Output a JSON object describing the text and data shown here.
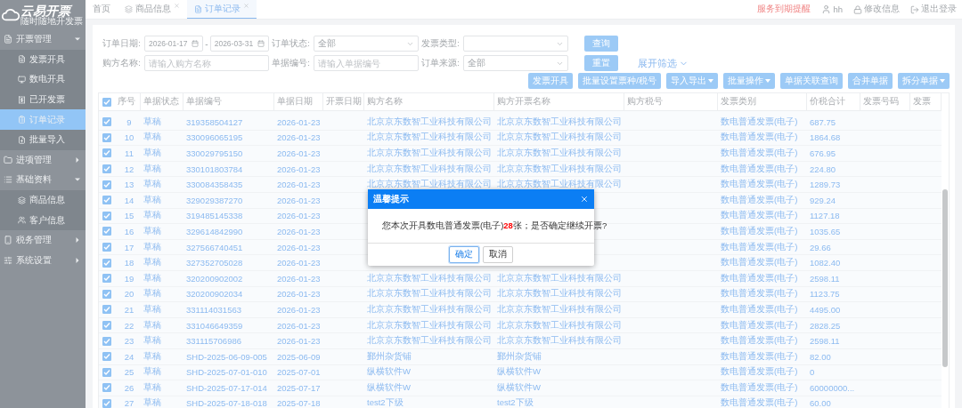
{
  "logo": {
    "name": "云易开票",
    "slogan": "随时随地开发票"
  },
  "sidebar": {
    "items": [
      {
        "label": "开票管理",
        "expanded": true,
        "children": [
          {
            "label": "发票开具",
            "selected": false
          },
          {
            "label": "数电开具",
            "selected": false
          },
          {
            "label": "已开发票",
            "selected": false
          },
          {
            "label": "订单记录",
            "selected": true
          },
          {
            "label": "批量导入",
            "selected": false
          }
        ]
      },
      {
        "label": "进项管理",
        "expanded": false
      },
      {
        "label": "基础资料",
        "expanded": true,
        "children": [
          {
            "label": "商品信息",
            "selected": false
          },
          {
            "label": "客户信息",
            "selected": false
          }
        ]
      },
      {
        "label": "税务管理",
        "expanded": false
      },
      {
        "label": "系统设置",
        "expanded": false
      }
    ]
  },
  "tabs": [
    {
      "label": "首页",
      "selected": false,
      "closable": false
    },
    {
      "label": "商品信息",
      "selected": false,
      "closable": true
    },
    {
      "label": "订单记录",
      "selected": true,
      "closable": true
    }
  ],
  "header_links": {
    "reminder": "服务到期提醒",
    "user": "hh",
    "edit_info": "修改信息",
    "logout": "退出登录"
  },
  "filters": [
    {
      "label": "订单日期:",
      "kind": "daterange",
      "from": "2026-01-17",
      "to": "2026-03-31",
      "separator": "-"
    },
    {
      "label": "订单状态:",
      "kind": "select",
      "value": "全部"
    },
    {
      "label": "发票类型:",
      "kind": "select"
    },
    {
      "label": "购方名称:",
      "kind": "input",
      "placeholder": "请输入购方名称"
    },
    {
      "label": "单据编号:",
      "kind": "input",
      "placeholder": "请输入单据编号"
    },
    {
      "label": "订单来源:",
      "kind": "select",
      "value": "全部"
    }
  ],
  "search_buttons": [
    "查询",
    "重置"
  ],
  "expand_link": "展开筛选",
  "actions": [
    {
      "label": "发票开具",
      "dropdown": false
    },
    {
      "label": "批量设置票种/税号",
      "dropdown": false
    },
    {
      "label": "导入导出",
      "dropdown": true
    },
    {
      "label": "批量操作",
      "dropdown": true
    },
    {
      "label": "单据关联查询",
      "dropdown": false
    },
    {
      "label": "合并单据",
      "dropdown": false
    },
    {
      "label": "拆分单据",
      "dropdown": true
    }
  ],
  "table": {
    "all_checked": true,
    "columns": [
      "序号",
      "单据状态",
      "单据编号",
      "单据日期",
      "开票日期",
      "购方名称",
      "购方开票名称",
      "购方税号",
      "发票类别",
      "价税合计",
      "发票号码",
      "发票"
    ],
    "rows": [
      {
        "checked": true,
        "no": "9",
        "status": "草稿",
        "code": "319358504127",
        "date": "2026-01-23",
        "buyer": "北京京东数智工业科技有限公司",
        "invoice_name": "北京京东数智工业科技有限公司",
        "type": "数电普通发票(电子)",
        "total": "687.75"
      },
      {
        "checked": true,
        "no": "10",
        "status": "草稿",
        "code": "330096065195",
        "date": "2026-01-23",
        "buyer": "北京京东数智工业科技有限公司",
        "invoice_name": "北京京东数智工业科技有限公司",
        "type": "数电普通发票(电子)",
        "total": "1864.68"
      },
      {
        "checked": true,
        "no": "11",
        "status": "草稿",
        "code": "330029795150",
        "date": "2026-01-23",
        "buyer": "北京京东数智工业科技有限公司",
        "invoice_name": "北京京东数智工业科技有限公司",
        "type": "数电普通发票(电子)",
        "total": "676.95"
      },
      {
        "checked": true,
        "no": "12",
        "status": "草稿",
        "code": "330101803784",
        "date": "2026-01-23",
        "buyer": "北京京东数智工业科技有限公司",
        "invoice_name": "北京京东数智工业科技有限公司",
        "type": "数电普通发票(电子)",
        "total": "224.80"
      },
      {
        "checked": true,
        "no": "13",
        "status": "草稿",
        "code": "330084358435",
        "date": "2026-01-23",
        "buyer": "北京京东数智工业科技有限公司",
        "invoice_name": "北京京东数智工业科技有限公司",
        "type": "数电普通发票(电子)",
        "total": "1289.73"
      },
      {
        "checked": true,
        "no": "14",
        "status": "草稿",
        "code": "329029387270",
        "date": "2026-01-23",
        "type": "数电普通发票(电子)",
        "total": "929.24"
      },
      {
        "checked": true,
        "no": "15",
        "status": "草稿",
        "code": "319485145338",
        "date": "2026-01-23",
        "type": "数电普通发票(电子)",
        "total": "1127.18"
      },
      {
        "checked": true,
        "no": "16",
        "status": "草稿",
        "code": "329614842990",
        "date": "2026-01-23",
        "type": "数电普通发票(电子)",
        "total": "1035.65"
      },
      {
        "checked": true,
        "no": "17",
        "status": "草稿",
        "code": "327566740451",
        "date": "2026-01-23",
        "type": "数电普通发票(电子)",
        "total": "29.66"
      },
      {
        "checked": true,
        "no": "18",
        "status": "草稿",
        "code": "327352705028",
        "date": "2026-01-23",
        "type": "数电普通发票(电子)",
        "total": "1082.40"
      },
      {
        "checked": true,
        "no": "19",
        "status": "草稿",
        "code": "320200902002",
        "date": "2026-01-23",
        "buyer": "北京京东数智工业科技有限公司",
        "invoice_name": "北京京东数智工业科技有限公司",
        "type": "数电普通发票(电子)",
        "total": "2598.11"
      },
      {
        "checked": true,
        "no": "20",
        "status": "草稿",
        "code": "320200902034",
        "date": "2026-01-23",
        "buyer": "北京京东数智工业科技有限公司",
        "invoice_name": "北京京东数智工业科技有限公司",
        "type": "数电普通发票(电子)",
        "total": "1123.75"
      },
      {
        "checked": true,
        "no": "21",
        "status": "草稿",
        "code": "331114031563",
        "date": "2026-01-23",
        "buyer": "北京京东数智工业科技有限公司",
        "invoice_name": "北京京东数智工业科技有限公司",
        "type": "数电普通发票(电子)",
        "total": "4495.00"
      },
      {
        "checked": true,
        "no": "22",
        "status": "草稿",
        "code": "331046649359",
        "date": "2026-01-23",
        "buyer": "北京京东数智工业科技有限公司",
        "invoice_name": "北京京东数智工业科技有限公司",
        "type": "数电普通发票(电子)",
        "total": "2828.25"
      },
      {
        "checked": true,
        "no": "23",
        "status": "草稿",
        "code": "331115706986",
        "date": "2026-01-23",
        "buyer": "北京京东数智工业科技有限公司",
        "invoice_name": "北京京东数智工业科技有限公司",
        "type": "数电普通发票(电子)",
        "total": "2598.11"
      },
      {
        "checked": true,
        "no": "24",
        "status": "草稿",
        "code": "SHD-2025-06-09-005",
        "date": "2025-06-09",
        "buyer": "鄞州杂货铺",
        "invoice_name": "鄞州杂货铺",
        "type": "数电普通发票(电子)",
        "total": "82.00"
      },
      {
        "checked": true,
        "no": "25",
        "status": "草稿",
        "code": "SHD-2025-07-01-010",
        "date": "2025-07-01",
        "buyer": "纵横软件W",
        "invoice_name": "纵横软件W",
        "type": "数电普通发票(电子)",
        "total": "0"
      },
      {
        "checked": true,
        "no": "26",
        "status": "草稿",
        "code": "SHD-2025-07-17-014",
        "date": "2025-07-17",
        "buyer": "纵横软件W",
        "invoice_name": "纵横软件W",
        "type": "数电普通发票(电子)",
        "total": "60000000..."
      },
      {
        "checked": true,
        "no": "27",
        "status": "草稿",
        "code": "SHD-2025-07-18-018",
        "date": "2025-07-18",
        "buyer": "test2下级",
        "invoice_name": "test2下级",
        "type": "数电普通发票(电子)",
        "total": "60.00"
      }
    ]
  },
  "dialog": {
    "title": "温馨提示",
    "message": "您本次开具数电普通发票(电子)**28**张；是否确定继续开票?",
    "buttons": [
      {
        "label": "确定",
        "focused": true
      },
      {
        "label": "取消",
        "focused": false
      }
    ]
  }
}
